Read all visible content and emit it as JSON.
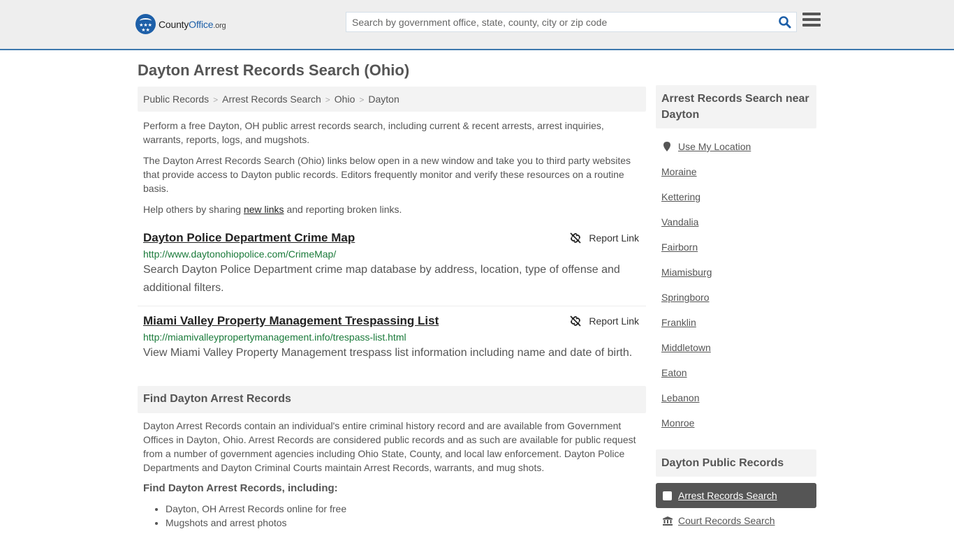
{
  "header": {
    "logo": {
      "county": "County",
      "office": "Office",
      "org": ".org"
    },
    "search": {
      "placeholder": "Search by government office, state, county, city or zip code",
      "value": ""
    },
    "icons": {
      "search": "search-icon",
      "menu": "hamburger-menu-icon"
    }
  },
  "page": {
    "title": "Dayton Arrest Records Search (Ohio)"
  },
  "breadcrumb": [
    {
      "label": "Public Records"
    },
    {
      "label": "Arrest Records Search"
    },
    {
      "label": "Ohio"
    },
    {
      "label": "Dayton"
    }
  ],
  "breadcrumb_separator": ">",
  "intro": {
    "p1": "Perform a free Dayton, OH public arrest records search, including current & recent arrests, arrest inquiries, warrants, reports, logs, and mugshots.",
    "p2": "The Dayton Arrest Records Search (Ohio) links below open in a new window and take you to third party websites that provide access to Dayton public records. Editors frequently monitor and verify these resources on a routine basis.",
    "p3_before": "Help others by sharing ",
    "p3_link": "new links",
    "p3_after": " and reporting broken links."
  },
  "results": [
    {
      "title": "Dayton Police Department Crime Map",
      "url": "http://www.daytonohiopolice.com/CrimeMap/",
      "description": "Search Dayton Police Department crime map database by address, location, type of offense and additional filters.",
      "report_label": "Report Link"
    },
    {
      "title": "Miami Valley Property Management Trespassing List",
      "url": "http://miamivalleypropertymanagement.info/trespass-list.html",
      "description": "View Miami Valley Property Management trespass list information including name and date of birth.",
      "report_label": "Report Link"
    }
  ],
  "find_section": {
    "heading": "Find Dayton Arrest Records",
    "body": "Dayton Arrest Records contain an individual's entire criminal history record and are available from Government Offices in Dayton, Ohio. Arrest Records are considered public records and as such are available for public request from a number of government agencies including Ohio State, County, and local law enforcement. Dayton Police Departments and Dayton Criminal Courts maintain Arrest Records, warrants, and mug shots.",
    "subheading": "Find Dayton Arrest Records, including:",
    "items": [
      "Dayton, OH Arrest Records online for free",
      "Mugshots and arrest photos"
    ]
  },
  "sidebar": {
    "nearby_heading": "Arrest Records Search near Dayton",
    "use_location": "Use My Location",
    "nearby": [
      "Moraine",
      "Kettering",
      "Vandalia",
      "Fairborn",
      "Miamisburg",
      "Springboro",
      "Franklin",
      "Middletown",
      "Eaton",
      "Lebanon",
      "Monroe"
    ],
    "public_records_heading": "Dayton Public Records",
    "public_records": [
      {
        "label": "Arrest Records Search",
        "active": true,
        "icon": "square-icon"
      },
      {
        "label": "Court Records Search",
        "active": false,
        "icon": "courthouse-icon"
      }
    ]
  },
  "colors": {
    "brand_blue": "#1d5fa8",
    "header_border": "#3d78ad",
    "url_green": "#1a7a3a",
    "active_item_bg": "#555555"
  }
}
